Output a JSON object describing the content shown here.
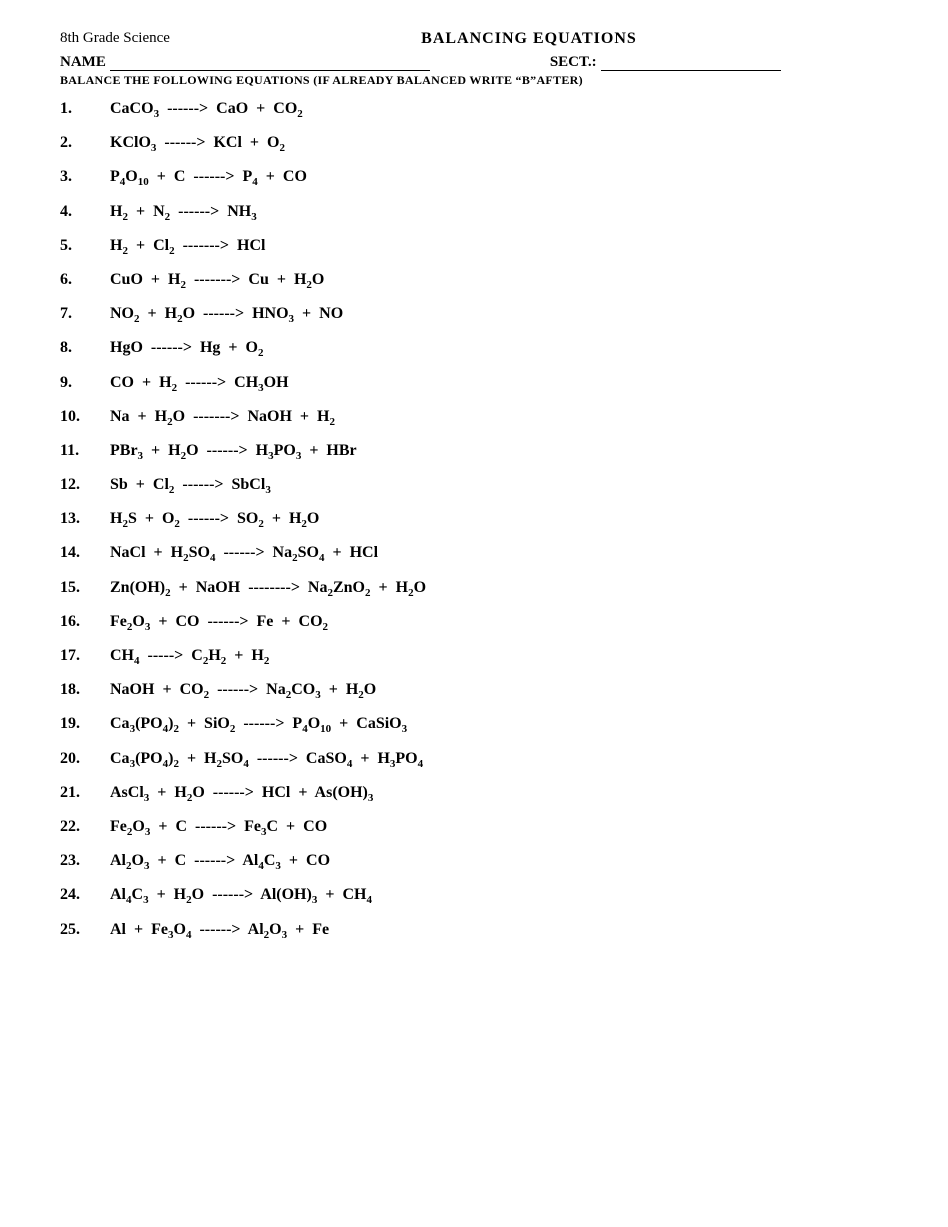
{
  "header": {
    "subject": "8th Grade Science",
    "title": "BALANCING EQUATIONS",
    "name_label": "NAME",
    "sect_label": "SECT.:",
    "instructions": "BALANCE THE FOLLOWING EQUATIONS (IF ALREADY BALANCED WRITE “B”AFTER)"
  },
  "equations": [
    {
      "num": "1.",
      "html": "CaCO<sub>3</sub> &nbsp;------&gt;&nbsp; CaO &nbsp;+&nbsp; CO<sub>2</sub>"
    },
    {
      "num": "2.",
      "html": "KClO<sub>3</sub> &nbsp;------&gt;&nbsp; KCl &nbsp;+&nbsp; O<sub>2</sub>"
    },
    {
      "num": "3.",
      "html": "P<sub>4</sub>O<sub>10</sub> &nbsp;+&nbsp; C &nbsp;------&gt;&nbsp; P<sub>4</sub> &nbsp;+&nbsp; CO"
    },
    {
      "num": "4.",
      "html": "H<sub>2</sub> &nbsp;+&nbsp; N<sub>2</sub> &nbsp;------&gt;&nbsp; NH<sub>3</sub>"
    },
    {
      "num": "5.",
      "html": "H<sub>2</sub> &nbsp;+&nbsp; Cl<sub>2</sub> &nbsp;-------&gt;&nbsp; HCl"
    },
    {
      "num": "6.",
      "html": "CuO &nbsp;+&nbsp; H<sub>2</sub> &nbsp;-------&gt;&nbsp; Cu &nbsp;+&nbsp; H<sub>2</sub>O"
    },
    {
      "num": "7.",
      "html": "NO<sub>2</sub> &nbsp;+&nbsp; H<sub>2</sub>O &nbsp;------&gt;&nbsp; HNO<sub>3</sub> &nbsp;+&nbsp; NO"
    },
    {
      "num": "8.",
      "html": "HgO &nbsp;------&gt;&nbsp; Hg &nbsp;+&nbsp; O<sub>2</sub>"
    },
    {
      "num": "9.",
      "html": "CO &nbsp;+&nbsp; H<sub>2</sub> &nbsp;------&gt;&nbsp; CH<sub>3</sub>OH"
    },
    {
      "num": "10.",
      "html": "Na &nbsp;+&nbsp; H<sub>2</sub>O &nbsp;-------&gt;&nbsp; NaOH &nbsp;+&nbsp; H<sub>2</sub>"
    },
    {
      "num": "11.",
      "html": "PBr<sub>3</sub> &nbsp;+&nbsp; H<sub>2</sub>O &nbsp;------&gt;&nbsp; H<sub>3</sub>PO<sub>3</sub> &nbsp;+&nbsp; HBr"
    },
    {
      "num": "12.",
      "html": "Sb &nbsp;+&nbsp; Cl<sub>2</sub> &nbsp;------&gt;&nbsp; SbCl<sub>3</sub>"
    },
    {
      "num": "13.",
      "html": "H<sub>2</sub>S &nbsp;+&nbsp; O<sub>2</sub> &nbsp;------&gt;&nbsp; SO<sub>2</sub> &nbsp;+&nbsp; H<sub>2</sub>O"
    },
    {
      "num": "14.",
      "html": "NaCl &nbsp;+&nbsp; H<sub>2</sub>SO<sub>4</sub> &nbsp;------&gt;&nbsp; Na<sub>2</sub>SO<sub>4</sub> &nbsp;+&nbsp; HCl"
    },
    {
      "num": "15.",
      "html": "Zn(OH)<sub>2</sub> &nbsp;+&nbsp; NaOH &nbsp;--------&gt;&nbsp; Na<sub>2</sub>ZnO<sub>2</sub> &nbsp;+&nbsp; H<sub>2</sub>O"
    },
    {
      "num": "16.",
      "html": "Fe<sub>2</sub>O<sub>3</sub> &nbsp;+&nbsp; CO &nbsp;------&gt;&nbsp; Fe &nbsp;+&nbsp; CO<sub>2</sub>"
    },
    {
      "num": "17.",
      "html": "CH<sub>4</sub> &nbsp;-----&gt;&nbsp; C<sub>2</sub>H<sub>2</sub> &nbsp;+&nbsp; H<sub>2</sub>"
    },
    {
      "num": "18.",
      "html": "NaOH &nbsp;+&nbsp; CO<sub>2</sub> &nbsp;------&gt;&nbsp; Na<sub>2</sub>CO<sub>3</sub> &nbsp;+&nbsp; H<sub>2</sub>O"
    },
    {
      "num": "19.",
      "html": "Ca<sub>3</sub>(PO<sub>4</sub>)<sub>2</sub> &nbsp;+&nbsp; SiO<sub>2</sub> &nbsp;------&gt;&nbsp; P<sub>4</sub>O<sub>10</sub> &nbsp;+&nbsp; CaSiO<sub>3</sub>"
    },
    {
      "num": "20.",
      "html": "Ca<sub>3</sub>(PO<sub>4</sub>)<sub>2</sub> &nbsp;+&nbsp; H<sub>2</sub>SO<sub>4</sub> &nbsp;------&gt;&nbsp; CaSO<sub>4</sub> &nbsp;+&nbsp; H<sub>3</sub>PO<sub>4</sub>"
    },
    {
      "num": "21.",
      "html": "AsCl<sub>3</sub> &nbsp;+&nbsp; H<sub>2</sub>O &nbsp;------&gt;&nbsp; HCl &nbsp;+&nbsp; As(OH)<sub>3</sub>"
    },
    {
      "num": "22.",
      "html": "Fe<sub>2</sub>O<sub>3</sub> &nbsp;+&nbsp; C &nbsp;------&gt;&nbsp; Fe<sub>3</sub>C &nbsp;+&nbsp; CO"
    },
    {
      "num": "23.",
      "html": "Al<sub>2</sub>O<sub>3</sub> &nbsp;+&nbsp; C &nbsp;------&gt;&nbsp; Al<sub>4</sub>C<sub>3</sub> &nbsp;+&nbsp; CO"
    },
    {
      "num": "24.",
      "html": "Al<sub>4</sub>C<sub>3</sub> &nbsp;+&nbsp; H<sub>2</sub>O &nbsp;------&gt;&nbsp; Al(OH)<sub>3</sub> &nbsp;+&nbsp; CH<sub>4</sub>"
    },
    {
      "num": "25.",
      "html": "Al &nbsp;+&nbsp; Fe<sub>3</sub>O<sub>4</sub> &nbsp;------&gt;&nbsp; Al<sub>2</sub>O<sub>3</sub> &nbsp;+&nbsp; Fe"
    }
  ]
}
